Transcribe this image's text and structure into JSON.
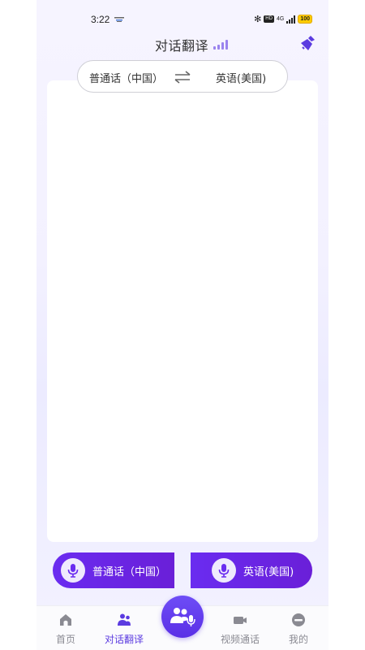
{
  "status_bar": {
    "time": "3:22",
    "network": "4G",
    "hd": "HD",
    "battery": "100"
  },
  "header": {
    "title": "对话翻译"
  },
  "language_selector": {
    "source": "普通话（中国）",
    "target": "英语(美国)"
  },
  "mic_buttons": {
    "left_label": "普通话（中国）",
    "right_label": "英语(美国)"
  },
  "bottom_nav": {
    "items": [
      {
        "label": "首页",
        "icon": "home-icon"
      },
      {
        "label": "对话翻译",
        "icon": "dialog-translate-icon"
      },
      {
        "label": "视频通话",
        "icon": "video-call-icon"
      },
      {
        "label": "我的",
        "icon": "profile-icon"
      }
    ],
    "active_index": 1,
    "center_icon": "voice-conversation-icon"
  },
  "colors": {
    "accent": "#5b3be0",
    "button_gradient_start": "#6a2cf0",
    "button_gradient_end": "#6a1fd8",
    "level_bars": "#9a83ee"
  }
}
